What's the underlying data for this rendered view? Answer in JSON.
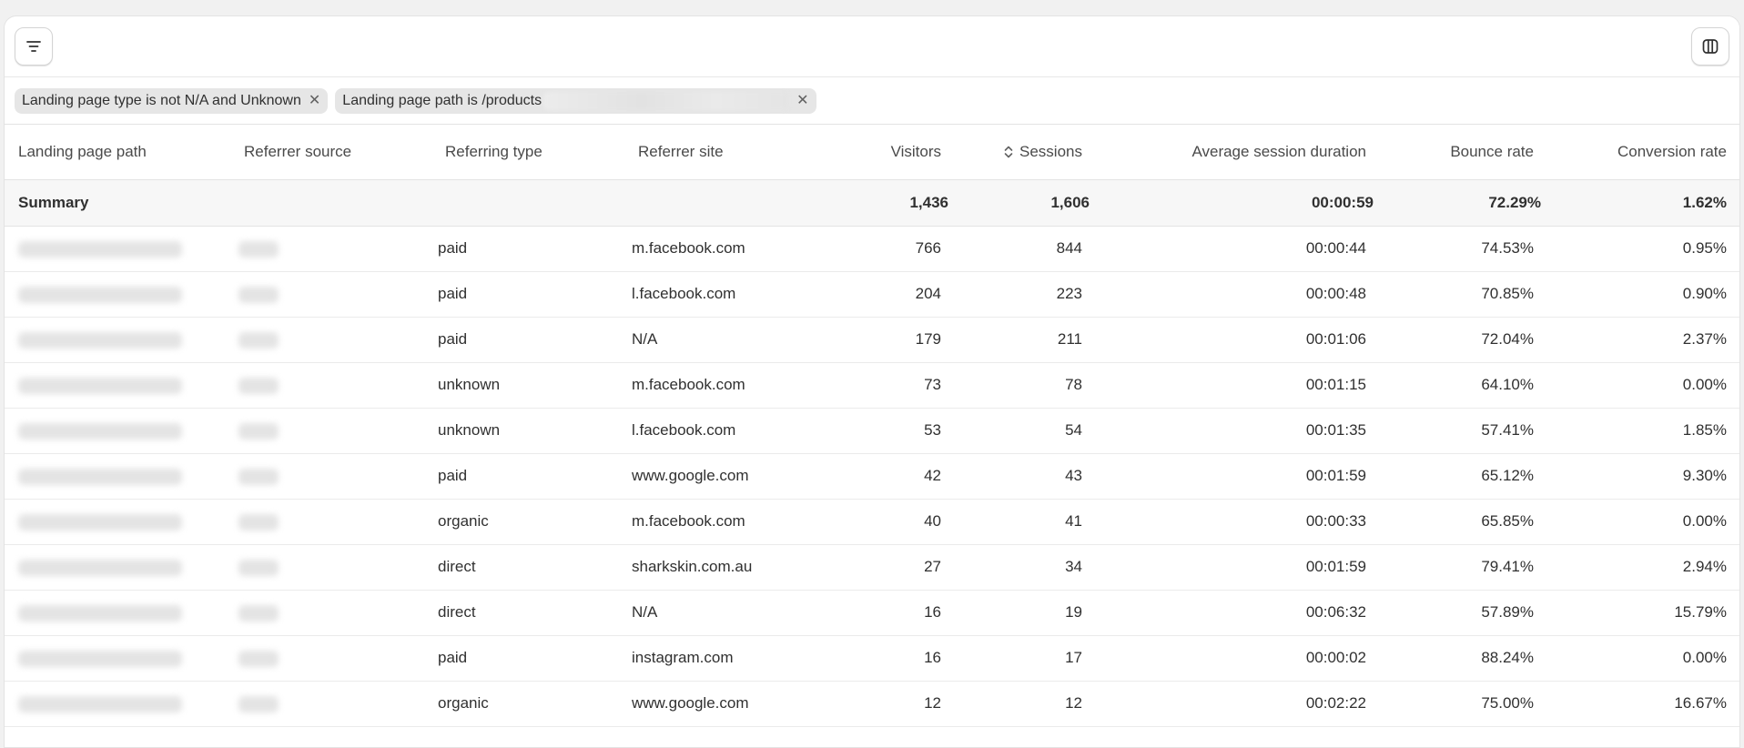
{
  "toolbar": {
    "filter_icon": "filter-lines-icon",
    "columns_icon": "columns-icon"
  },
  "filters": [
    {
      "label": "Landing page type is not N/A and Unknown"
    },
    {
      "label": "Landing page path is /products"
    }
  ],
  "table": {
    "columns": [
      "Landing page path",
      "Referrer source",
      "Referring type",
      "Referrer site",
      "Visitors",
      "Sessions",
      "Average session duration",
      "Bounce rate",
      "Conversion rate"
    ],
    "sorted_column_icon": "sort-updown-icon",
    "summary": {
      "label": "Summary",
      "visitors": "1,436",
      "sessions": "1,606",
      "avg_duration": "00:00:59",
      "bounce_rate": "72.29%",
      "conversion_rate": "1.62%"
    },
    "rows": [
      {
        "type": "paid",
        "site": "m.facebook.com",
        "visitors": "766",
        "sessions": "844",
        "duration": "00:00:44",
        "bounce": "74.53%",
        "conversion": "0.95%"
      },
      {
        "type": "paid",
        "site": "l.facebook.com",
        "visitors": "204",
        "sessions": "223",
        "duration": "00:00:48",
        "bounce": "70.85%",
        "conversion": "0.90%"
      },
      {
        "type": "paid",
        "site": "N/A",
        "visitors": "179",
        "sessions": "211",
        "duration": "00:01:06",
        "bounce": "72.04%",
        "conversion": "2.37%"
      },
      {
        "type": "unknown",
        "site": "m.facebook.com",
        "visitors": "73",
        "sessions": "78",
        "duration": "00:01:15",
        "bounce": "64.10%",
        "conversion": "0.00%"
      },
      {
        "type": "unknown",
        "site": "l.facebook.com",
        "visitors": "53",
        "sessions": "54",
        "duration": "00:01:35",
        "bounce": "57.41%",
        "conversion": "1.85%"
      },
      {
        "type": "paid",
        "site": "www.google.com",
        "visitors": "42",
        "sessions": "43",
        "duration": "00:01:59",
        "bounce": "65.12%",
        "conversion": "9.30%"
      },
      {
        "type": "organic",
        "site": "m.facebook.com",
        "visitors": "40",
        "sessions": "41",
        "duration": "00:00:33",
        "bounce": "65.85%",
        "conversion": "0.00%"
      },
      {
        "type": "direct",
        "site": "sharkskin.com.au",
        "visitors": "27",
        "sessions": "34",
        "duration": "00:01:59",
        "bounce": "79.41%",
        "conversion": "2.94%"
      },
      {
        "type": "direct",
        "site": "N/A",
        "visitors": "16",
        "sessions": "19",
        "duration": "00:06:32",
        "bounce": "57.89%",
        "conversion": "15.79%"
      },
      {
        "type": "paid",
        "site": "instagram.com",
        "visitors": "16",
        "sessions": "17",
        "duration": "00:00:02",
        "bounce": "88.24%",
        "conversion": "0.00%"
      },
      {
        "type": "organic",
        "site": "www.google.com",
        "visitors": "12",
        "sessions": "12",
        "duration": "00:02:22",
        "bounce": "75.00%",
        "conversion": "16.67%"
      }
    ]
  }
}
